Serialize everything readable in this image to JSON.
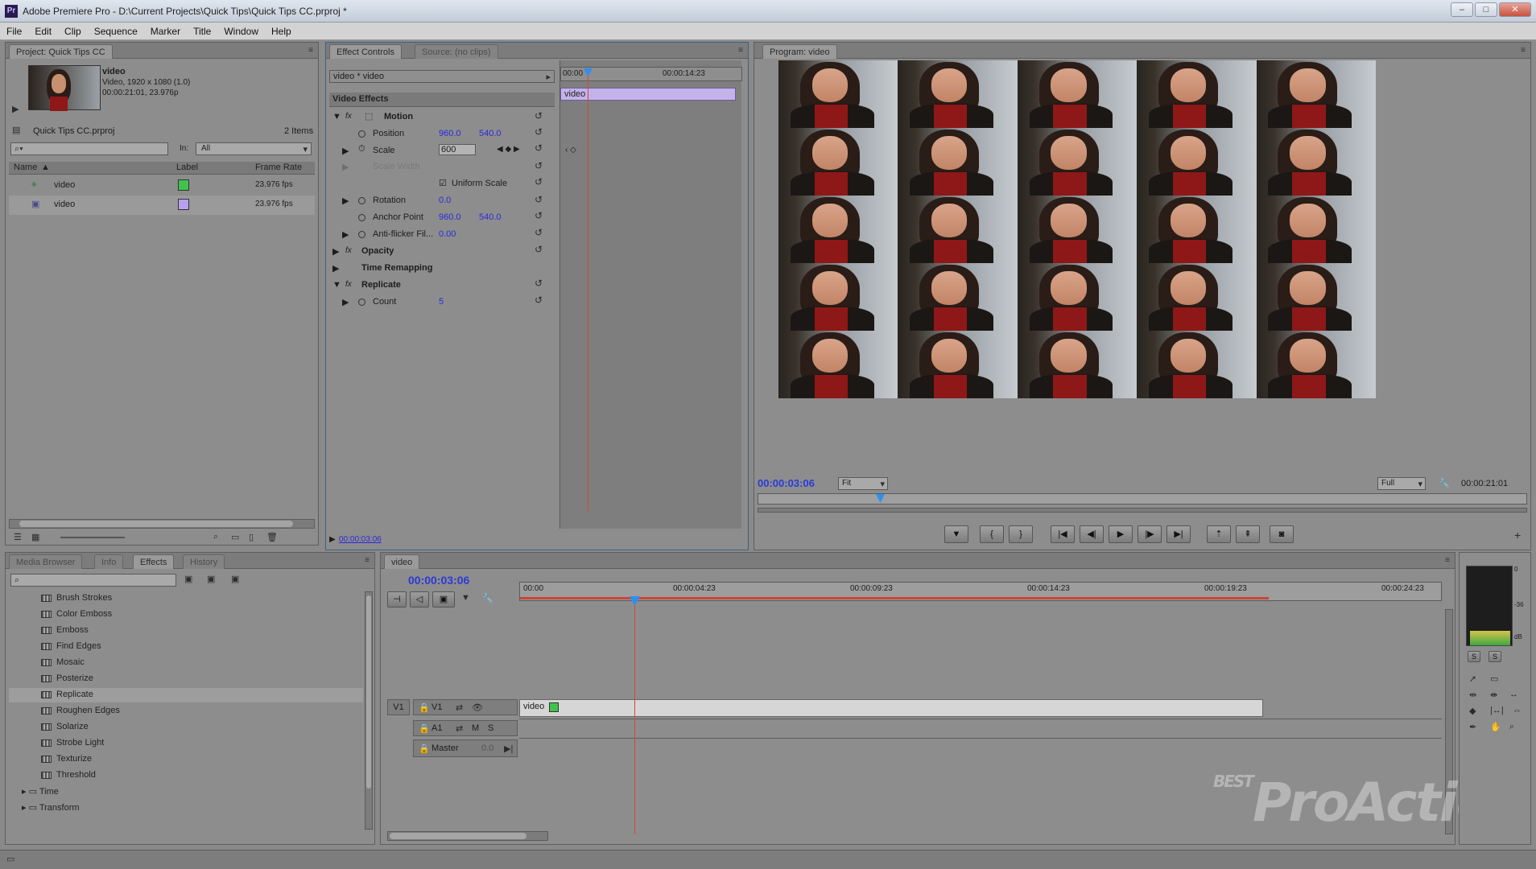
{
  "window": {
    "title": "Adobe Premiere Pro - D:\\Current Projects\\Quick Tips\\Quick Tips CC.prproj *",
    "controls": [
      "–",
      "□",
      "✕"
    ]
  },
  "menu": [
    "File",
    "Edit",
    "Clip",
    "Sequence",
    "Marker",
    "Title",
    "Window",
    "Help"
  ],
  "project": {
    "tab": "Project: Quick Tips CC",
    "clip_name": "video",
    "clip_info_1": "Video, 1920 x 1080 (1.0)",
    "clip_info_2": "00:00:21:01, 23.976p",
    "project_file": "Quick Tips CC.prproj",
    "item_count": "2 Items",
    "in_label": "In:",
    "in_value": "All",
    "columns": [
      "Name",
      "Label",
      "Frame Rate"
    ],
    "items": [
      {
        "name": "video",
        "label_color": "#3fc34c",
        "frame_rate": "23.976 fps"
      },
      {
        "name": "video",
        "label_color": "#b9a0ee",
        "frame_rate": "23.976 fps"
      }
    ]
  },
  "effect_controls": {
    "tabs": [
      "Effect Controls",
      "Source: (no clips)"
    ],
    "clip_path": "video * video",
    "ruler_start": "00:00",
    "ruler_end": "00:00:14:23",
    "clip_bar_label": "video",
    "section": "Video Effects",
    "motion": "Motion",
    "position_label": "Position",
    "position_x": "960.0",
    "position_y": "540.0",
    "scale_label": "Scale",
    "scale_value": "600",
    "scale_width_label": "Scale Width",
    "uniform_scale": "Uniform Scale",
    "rotation_label": "Rotation",
    "rotation_value": "0.0",
    "anchor_label": "Anchor Point",
    "anchor_x": "960.0",
    "anchor_y": "540.0",
    "antiflicker_label": "Anti-flicker Fil...",
    "antiflicker_value": "0.00",
    "opacity": "Opacity",
    "time_remapping": "Time Remapping",
    "replicate": "Replicate",
    "count_label": "Count",
    "count_value": "5",
    "timecode": "00:00:03:06"
  },
  "program": {
    "tab": "Program: video",
    "timecode": "00:00:03:06",
    "fit": "Fit",
    "quality": "Full",
    "duration": "00:00:21:01",
    "grid": 5
  },
  "effects_panel": {
    "tabs": [
      "Media Browser",
      "Info",
      "Effects",
      "History"
    ],
    "items": [
      "Brush Strokes",
      "Color Emboss",
      "Emboss",
      "Find Edges",
      "Mosaic",
      "Posterize",
      "Replicate",
      "Roughen Edges",
      "Solarize",
      "Strobe Light",
      "Texturize",
      "Threshold"
    ],
    "folders": [
      "Time",
      "Transform"
    ],
    "selected": "Replicate"
  },
  "timeline": {
    "tab": "video",
    "timecode": "00:00:03:06",
    "ruler": [
      "00:00",
      "00:00:04:23",
      "00:00:09:23",
      "00:00:14:23",
      "00:00:19:23",
      "00:00:24:23"
    ],
    "v1": "V1",
    "a1": "A1",
    "master": "Master",
    "master_value": "0.0",
    "clip_label": "video",
    "track_m": "M",
    "track_s": "S"
  },
  "meter": {
    "labels": [
      "0",
      "-36",
      "dB"
    ],
    "solo": [
      "S",
      "S"
    ]
  },
  "watermark": "ProAction",
  "watermark_small": "BEST"
}
